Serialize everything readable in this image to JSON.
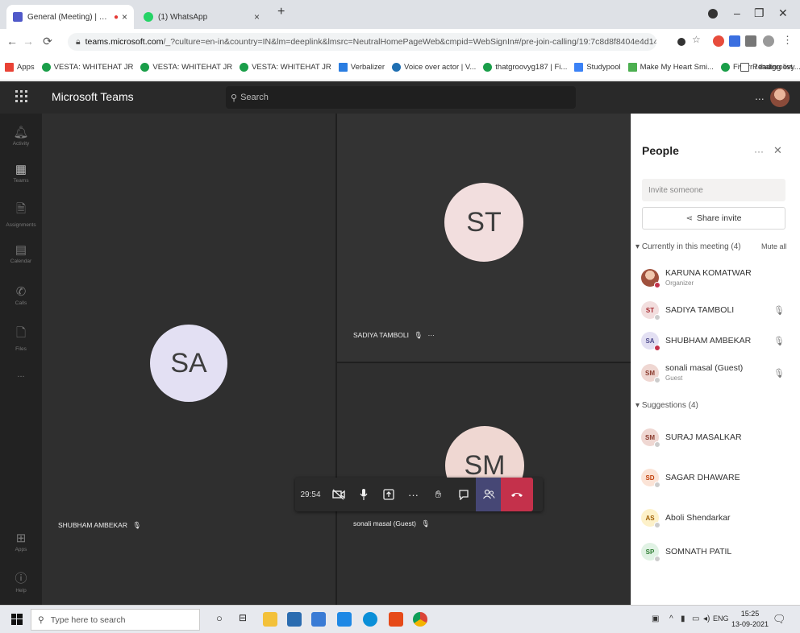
{
  "browser": {
    "tabs": [
      {
        "title": "General (Meeting) | Micros",
        "favicon_color": "#5059c9",
        "has_record_dot": true
      },
      {
        "title": "(1) WhatsApp",
        "favicon_color": "#25d366"
      }
    ],
    "url_prefix": "teams.microsoft.com",
    "url_rest": "/_?culture=en-in&country=IN&lm=deeplink&lmsrc=NeutralHomePageWeb&cmpid=WebSignIn#/pre-join-calling/19:7c8d8f8404e4d14bb7e33bd0b13167e@threa...",
    "bookmarks": [
      {
        "label": "Apps",
        "color": "#e94235"
      },
      {
        "label": "VESTA: WHITEHAT JR",
        "color": "#1a9e49"
      },
      {
        "label": "VESTA: WHITEHAT JR",
        "color": "#1a9e49"
      },
      {
        "label": "VESTA: WHITEHAT JR",
        "color": "#1a9e49"
      },
      {
        "label": "Verbalizer",
        "color": "#2a7de1"
      },
      {
        "label": "Voice over actor | V...",
        "color": "#1f6fb2"
      },
      {
        "label": "thatgroovyg187 | Fi...",
        "color": "#1a9e49"
      },
      {
        "label": "Studypool",
        "color": "#3b82f6"
      },
      {
        "label": "Make My Heart Smi...",
        "color": "#4caf50"
      },
      {
        "label": "Fiverr / thatgroovy...",
        "color": "#1a9e49"
      },
      {
        "label": "Reading list",
        "color": "#555555"
      }
    ]
  },
  "teams": {
    "app_title": "Microsoft Teams",
    "search_placeholder": "Search",
    "more": "...",
    "rail": [
      {
        "label": "Activity",
        "icon": "bell-icon"
      },
      {
        "label": "Teams",
        "icon": "teams-icon"
      },
      {
        "label": "Assignments",
        "icon": "assignments-icon"
      },
      {
        "label": "Calendar",
        "icon": "calendar-icon"
      },
      {
        "label": "Calls",
        "icon": "phone-icon"
      },
      {
        "label": "Files",
        "icon": "file-icon"
      },
      {
        "label": "...",
        "icon": "more-icon"
      },
      {
        "label": "Apps",
        "icon": "apps-icon"
      },
      {
        "label": "Help",
        "icon": "help-icon"
      }
    ],
    "tiles": {
      "main": {
        "initials": "SA",
        "name": "SHUBHAM AMBEKAR",
        "avatar_color": "#e3e0f3"
      },
      "top_right": {
        "initials": "ST",
        "name": "SADIYA TAMBOLI",
        "avatar_color": "#f2dede"
      },
      "bottom_right": {
        "initials": "SM",
        "name": "sonali masal (Guest)",
        "avatar_color": "#efd7d2"
      }
    },
    "call_bar": {
      "timer": "29:54"
    },
    "people_panel": {
      "title": "People",
      "invite_placeholder": "Invite someone",
      "share_label": "Share invite",
      "current_header": "Currently in this meeting (4)",
      "mute_all": "Mute all",
      "current": [
        {
          "initials": "",
          "name": "KARUNA KOMATWAR",
          "sub": "Organizer",
          "avatar_color": "#c98c7a",
          "text_color": "#fff",
          "dot_color": "#c4314b",
          "mic": false
        },
        {
          "initials": "ST",
          "name": "SADIYA TAMBOLI",
          "sub": "",
          "avatar_color": "#f2dede",
          "text_color": "#a4262c",
          "dot_color": "#cccccc",
          "mic": true
        },
        {
          "initials": "SA",
          "name": "SHUBHAM AMBEKAR",
          "sub": "",
          "avatar_color": "#e3e0f3",
          "text_color": "#4f4c8c",
          "dot_color": "#c4314b",
          "mic": true
        },
        {
          "initials": "SM",
          "name": "sonali masal (Guest)",
          "sub": "Guest",
          "avatar_color": "#efd7d2",
          "text_color": "#8a3b2e",
          "dot_color": "#cccccc",
          "mic": true
        }
      ],
      "suggestions_header": "Suggestions (4)",
      "suggestions": [
        {
          "initials": "SM",
          "name": "SURAJ MASALKAR",
          "avatar_color": "#efd7d2",
          "text_color": "#8a3b2e"
        },
        {
          "initials": "SD",
          "name": "SAGAR DHAWARE",
          "avatar_color": "#fbe3d6",
          "text_color": "#c2410c"
        },
        {
          "initials": "AS",
          "name": "Aboli Shendarkar",
          "avatar_color": "#fdf1c9",
          "text_color": "#a16207"
        },
        {
          "initials": "SP",
          "name": "SOMNATH PATIL",
          "avatar_color": "#e0f2e4",
          "text_color": "#2e7d32"
        }
      ]
    }
  },
  "taskbar": {
    "search_placeholder": "Type here to search",
    "lang": "ENG",
    "time": "15:25",
    "date": "13-09-2021"
  }
}
